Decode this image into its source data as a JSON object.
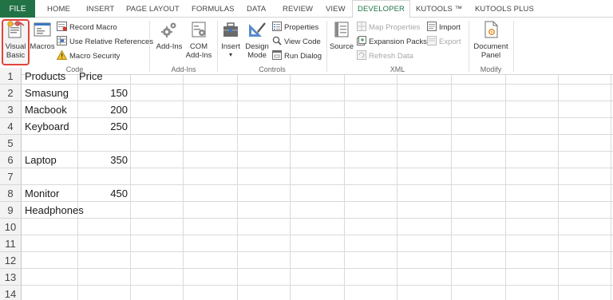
{
  "tabs": {
    "file": "FILE",
    "items": [
      "HOME",
      "INSERT",
      "PAGE LAYOUT",
      "FORMULAS",
      "DATA",
      "REVIEW",
      "VIEW",
      "DEVELOPER",
      "KUTOOLS ™",
      "KUTOOLS PLUS"
    ],
    "active": "DEVELOPER"
  },
  "ribbon": {
    "code": {
      "visual_basic_1": "Visual",
      "visual_basic_2": "Basic",
      "macros": "Macros",
      "record_macro": "Record Macro",
      "use_relative": "Use Relative References",
      "macro_security": "Macro Security",
      "label": "Code"
    },
    "addins": {
      "addins": "Add-Ins",
      "com_1": "COM",
      "com_2": "Add-Ins",
      "label": "Add-Ins"
    },
    "controls": {
      "insert": "Insert",
      "insert_arrow": "▾",
      "design_1": "Design",
      "design_2": "Mode",
      "properties": "Properties",
      "view_code": "View Code",
      "run_dialog": "Run Dialog",
      "label": "Controls"
    },
    "xml": {
      "source": "Source",
      "map_properties": "Map Properties",
      "expansion_packs": "Expansion Packs",
      "refresh_data": "Refresh Data",
      "import": "Import",
      "export": "Export",
      "label": "XML"
    },
    "modify": {
      "document_1": "Document",
      "document_2": "Panel",
      "label": "Modify"
    }
  },
  "sheet": {
    "row_numbers": [
      "1",
      "2",
      "3",
      "4",
      "5",
      "6",
      "7",
      "8",
      "9",
      "10",
      "11",
      "12",
      "13",
      "14"
    ],
    "rows": [
      {
        "a": "Products",
        "b": "Price"
      },
      {
        "a": "Smasung",
        "b": "150"
      },
      {
        "a": "Macbook",
        "b": "200"
      },
      {
        "a": "Keyboard",
        "b": "250"
      },
      {
        "a": "",
        "b": ""
      },
      {
        "a": "Laptop",
        "b": "350"
      },
      {
        "a": "",
        "b": ""
      },
      {
        "a": "Monitor",
        "b": "450"
      },
      {
        "a": "Headphones",
        "b": ""
      },
      {
        "a": "",
        "b": ""
      },
      {
        "a": "",
        "b": ""
      },
      {
        "a": "",
        "b": ""
      },
      {
        "a": "",
        "b": ""
      },
      {
        "a": "",
        "b": ""
      }
    ]
  },
  "colors": {
    "file_tab": "#217346",
    "active_tab_text": "#217346",
    "highlight_border": "#e0443a"
  }
}
